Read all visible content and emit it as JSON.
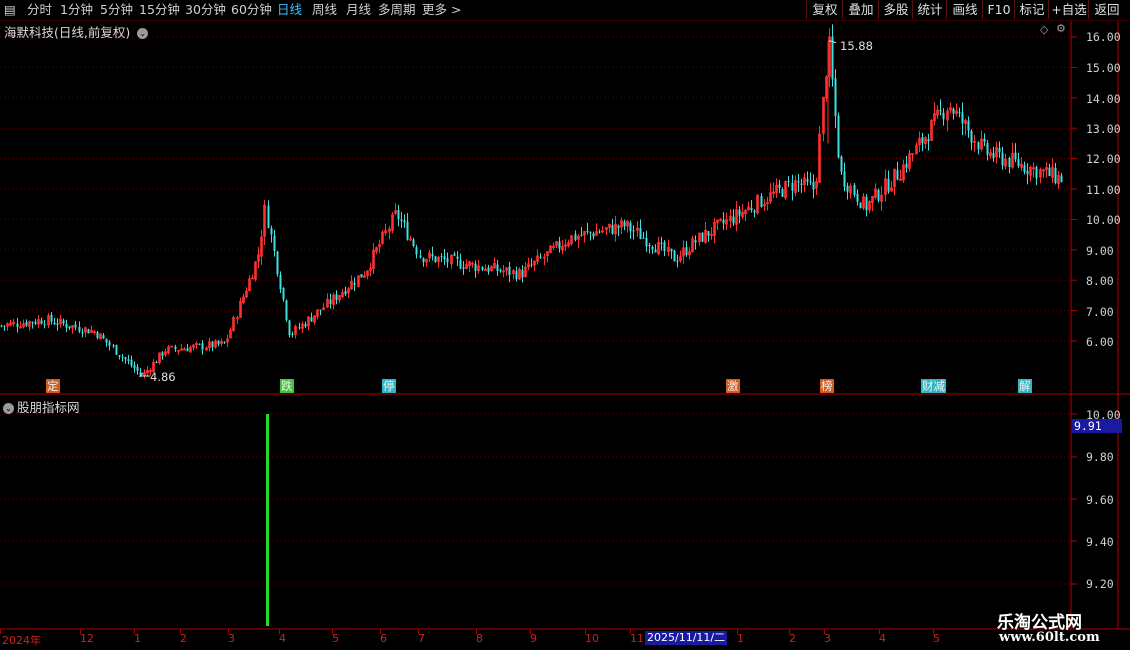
{
  "toolbar": {
    "periods": [
      "分时",
      "1分钟",
      "5分钟",
      "15分钟",
      "30分钟",
      "60分钟",
      "日线",
      "周线",
      "月线",
      "多周期",
      "更多 >"
    ],
    "active_period": "日线",
    "buttons": [
      "复权",
      "叠加",
      "多股",
      "统计",
      "画线",
      "F10",
      "标记",
      "+自选",
      "返回"
    ],
    "menu_glyph": "▤"
  },
  "main_chart": {
    "title": "海默科技(日线,前复权)",
    "high_label": "15.88",
    "low_label": "4.86",
    "signals": [
      {
        "text": "定",
        "color": "#e06020"
      },
      {
        "text": "跌",
        "color": "#40d040"
      },
      {
        "text": "停",
        "color": "#30c0d0"
      },
      {
        "text": "激",
        "color": "#e06020"
      },
      {
        "text": "榜",
        "color": "#e06020"
      },
      {
        "text": "财减",
        "color": "#30c0d0"
      },
      {
        "text": "解",
        "color": "#30c0d0"
      }
    ],
    "yaxis_labels": [
      "16.00",
      "15.00",
      "14.00",
      "13.00",
      "12.00",
      "11.00",
      "10.00",
      "9.00",
      "8.00",
      "7.00",
      "6.00"
    ]
  },
  "indicator": {
    "title": "股朋指标网",
    "yaxis_labels": [
      "10.00",
      "9.80",
      "9.60",
      "9.40",
      "9.20"
    ],
    "current_value": "9.91",
    "bar_color": "#22dd22"
  },
  "xaxis": {
    "labels": [
      "2024年",
      "12",
      "1",
      "2",
      "3",
      "4",
      "5",
      "6",
      "7",
      "8",
      "9",
      "10",
      "11",
      "1",
      "2",
      "3",
      "4",
      "5"
    ],
    "cursor_date": "2025/11/11/二"
  },
  "watermark": {
    "line1": "乐淘公式网",
    "line2": "www.60lt.com"
  },
  "chart_data": {
    "type": "candlestick",
    "title": "海默科技(日线,前复权)",
    "ylim": [
      4.6,
      16.3
    ],
    "close_path": [
      [
        "start",
        6.5
      ],
      [
        "2024年",
        6.7
      ],
      [
        "12",
        6.3
      ],
      [
        "1",
        5.3
      ],
      [
        "low",
        4.86
      ],
      [
        "2",
        5.7
      ],
      [
        "3",
        5.9
      ],
      [
        "pre-4",
        8.8
      ],
      [
        "spike",
        10.4
      ],
      [
        "4",
        6.2
      ],
      [
        "5",
        7.3
      ],
      [
        "6",
        8.3
      ],
      [
        "6b",
        10.2
      ],
      [
        "7",
        8.8
      ],
      [
        "8",
        8.5
      ],
      [
        "9",
        8.2
      ],
      [
        "10",
        9.4
      ],
      [
        "11",
        9.8
      ],
      [
        "11b",
        8.7
      ],
      [
        "1",
        9.4
      ],
      [
        "2",
        10.6
      ],
      [
        "2b",
        11.2
      ],
      [
        "3",
        11.0
      ],
      [
        "high",
        15.88
      ],
      [
        "3b",
        11.5
      ],
      [
        "4",
        10.4
      ],
      [
        "4b",
        11.6
      ],
      [
        "5",
        13.8
      ],
      [
        "5b",
        12.2
      ],
      [
        "end",
        11.3
      ]
    ]
  }
}
